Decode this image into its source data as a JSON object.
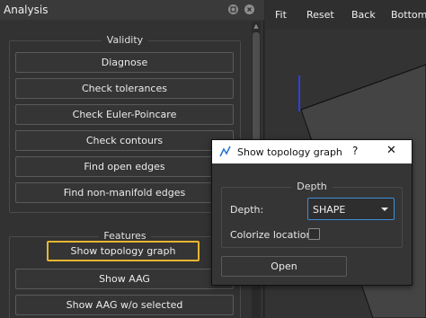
{
  "analysis_panel": {
    "title": "Analysis",
    "validity_group": {
      "title": "Validity",
      "buttons": [
        "Diagnose",
        "Check tolerances",
        "Check Euler-Poincare",
        "Check contours",
        "Find open edges",
        "Find non-manifold edges"
      ]
    },
    "features_group": {
      "title": "Features",
      "buttons": [
        "Show topology graph",
        "Show AAG",
        "Show AAG w/o selected"
      ]
    }
  },
  "viewer_toolbar": {
    "buttons": [
      "Fit",
      "Reset",
      "Back",
      "Bottom"
    ]
  },
  "dialog": {
    "title": "Show topology graph",
    "help": "?",
    "close": "✕",
    "group_title": "Depth",
    "depth_label": "Depth:",
    "depth_value": "SHAPE",
    "colorize_label": "Colorize locations:",
    "colorize_checked": false,
    "open_label": "Open"
  },
  "colors": {
    "highlight_border": "#e8b530",
    "combo_focus": "#3d8ed8",
    "axis_blue": "#2f3fe0"
  }
}
